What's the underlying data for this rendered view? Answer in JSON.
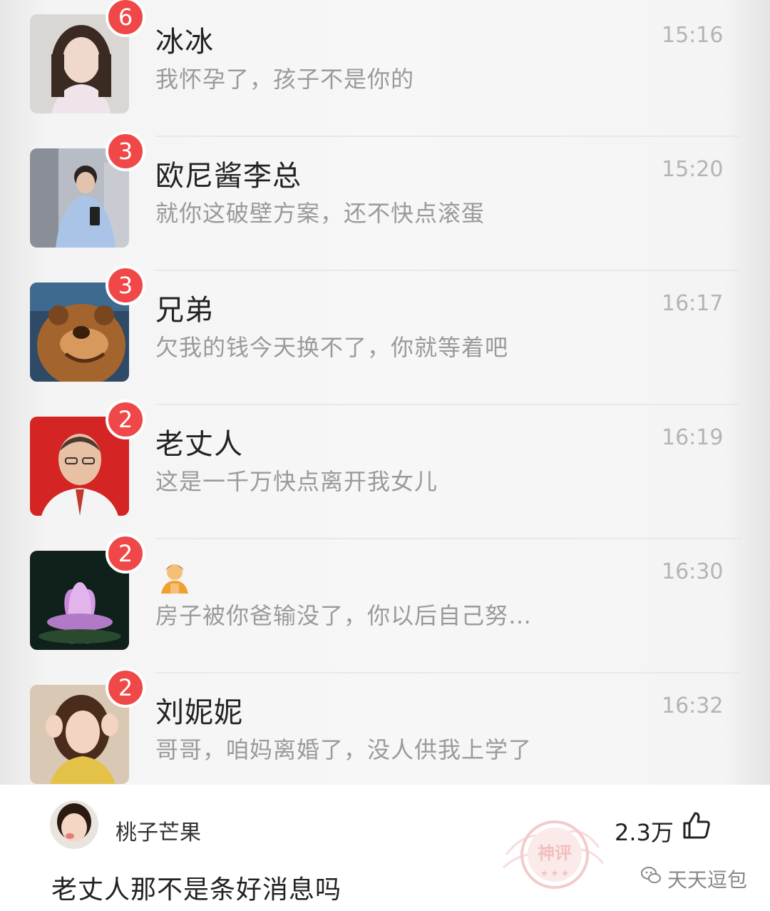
{
  "chats": [
    {
      "name": "冰冰",
      "preview": "我怀孕了，孩子不是你的",
      "time": "15:16",
      "unread": "6",
      "avatar": "girl-avatar"
    },
    {
      "name": "欧尼酱李总",
      "preview": "就你这破壁方案，还不快点滚蛋",
      "time": "15:20",
      "unread": "3",
      "avatar": "man-in-elevator-avatar"
    },
    {
      "name": "兄弟",
      "preview": "欠我的钱今天换不了，你就等着吧",
      "time": "16:17",
      "unread": "3",
      "avatar": "cartoon-bear-avatar"
    },
    {
      "name": "老丈人",
      "preview": "这是一千万快点离开我女儿",
      "time": "16:19",
      "unread": "2",
      "avatar": "old-man-avatar"
    },
    {
      "name": "",
      "preview": "房子被你爸输没了，你以后自己努…",
      "time": "16:30",
      "unread": "2",
      "avatar": "lotus-avatar",
      "name_icon": "person-emoji-icon"
    },
    {
      "name": "刘妮妮",
      "preview": "哥哥，咱妈离婚了，没人供我上学了",
      "time": "16:32",
      "unread": "2",
      "avatar": "young-woman-avatar"
    }
  ],
  "comment": {
    "username": "桃子芒果",
    "text": "老丈人那不是条好消息吗",
    "likes": "2.3万",
    "stamp_text": "神评"
  },
  "watermark": "天天逗包",
  "colors": {
    "badge": "#f04848",
    "name": "#222222",
    "preview": "#9a9a9a",
    "time": "#b4b4b4"
  }
}
